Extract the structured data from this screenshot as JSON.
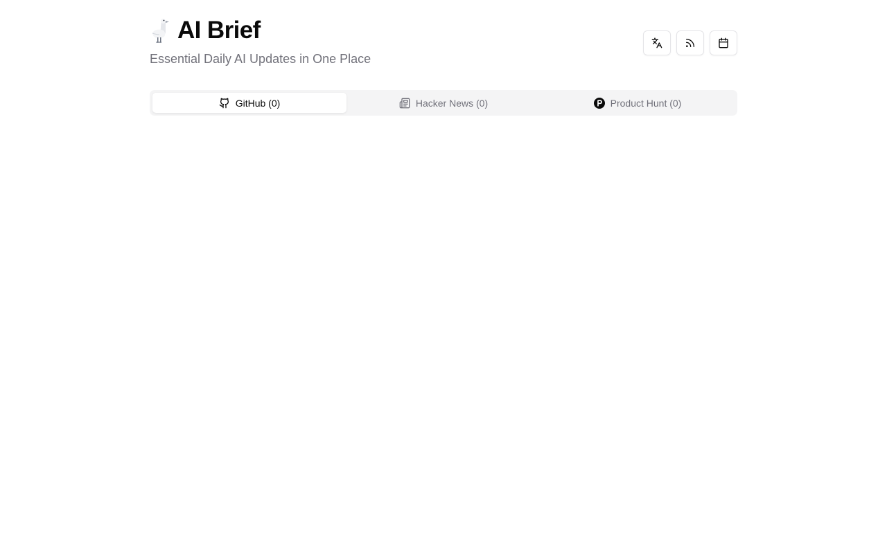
{
  "header": {
    "logo_icon": "goose-emoji-icon",
    "title": "AI Brief",
    "subtitle": "Essential Daily AI Updates in One Place",
    "actions": [
      {
        "icon": "translate-icon"
      },
      {
        "icon": "rss-icon"
      },
      {
        "icon": "calendar-icon"
      }
    ]
  },
  "tabs": [
    {
      "label": "GitHub",
      "count": "(0)",
      "icon": "github-icon",
      "active": true
    },
    {
      "label": "Hacker News",
      "count": "(0)",
      "icon": "newspaper-icon",
      "active": false
    },
    {
      "label": "Product Hunt",
      "count": "(0)",
      "icon": "product-hunt-icon",
      "active": false
    }
  ],
  "colors": {
    "background": "#ffffff",
    "title": "#0a0a0a",
    "muted": "#71717a",
    "tab_track": "#f4f4f5",
    "border": "#e4e4e7"
  }
}
